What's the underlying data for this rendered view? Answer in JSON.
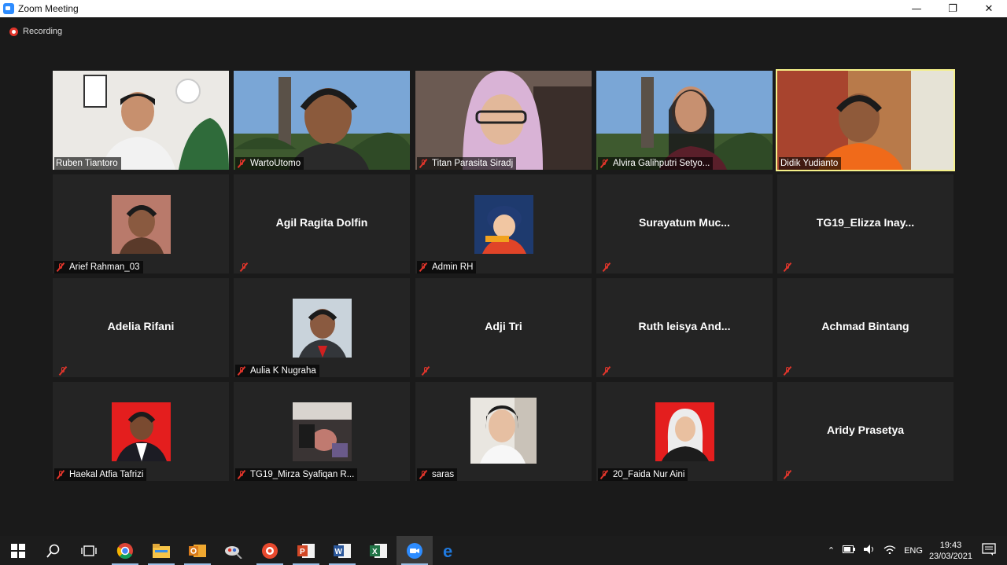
{
  "window": {
    "title": "Zoom Meeting",
    "minimize": "—",
    "maximize": "❐",
    "close": "✕"
  },
  "recording": {
    "label": "Recording"
  },
  "participants": [
    {
      "name": "Ruben Tiantoro",
      "video": true,
      "muted": false
    },
    {
      "name": "WartoUtomo",
      "video": true,
      "muted": true
    },
    {
      "name": "Titan Parasita Siradj",
      "video": true,
      "muted": true
    },
    {
      "name": "Alvira Galihputri Setyo...",
      "video": true,
      "muted": true
    },
    {
      "name": "Didik Yudianto",
      "video": true,
      "muted": false,
      "active_speaker": true
    },
    {
      "name": "Arief Rahman_03",
      "avatar": true,
      "muted": true
    },
    {
      "name": "",
      "display_name": "Agil Ragita Dolfin",
      "muted": true
    },
    {
      "name": "Admin RH",
      "avatar": true,
      "muted": true
    },
    {
      "name": "",
      "display_name": "Surayatum Muc...",
      "muted": true
    },
    {
      "name": "",
      "display_name": "TG19_Elizza Inay...",
      "muted": true
    },
    {
      "name": "",
      "display_name": "Adelia Rifani",
      "muted": true
    },
    {
      "name": "Aulia K Nugraha",
      "avatar": true,
      "muted": true
    },
    {
      "name": "",
      "display_name": "Adji Tri",
      "muted": true
    },
    {
      "name": "",
      "display_name": "Ruth leisya And...",
      "muted": true
    },
    {
      "name": "",
      "display_name": "Achmad Bintang",
      "muted": true
    },
    {
      "name": "Haekal Atfia Tafrizi",
      "avatar": true,
      "muted": true
    },
    {
      "name": "TG19_Mirza Syafiqan R...",
      "avatar": true,
      "muted": true
    },
    {
      "name": "saras",
      "avatar": true,
      "muted": true
    },
    {
      "name": "20_Faida Nur Aini",
      "avatar": true,
      "muted": true
    },
    {
      "name": "",
      "display_name": "Aridy Prasetya",
      "muted": true
    }
  ],
  "taskbar": {
    "apps": [
      "start-icon",
      "search-icon",
      "task-view-icon",
      "chrome-icon",
      "file-explorer-icon",
      "outlook-icon",
      "snipping-icon",
      "screen-recorder-icon",
      "powerpoint-icon",
      "word-icon",
      "excel-icon",
      "zoom-icon",
      "edge-icon"
    ],
    "language": "ENG",
    "time": "19:43",
    "date": "23/03/2021"
  },
  "colors": {
    "active_speaker_border": "#f4f089",
    "mute": "#e0352b",
    "tile_bg": "#242424",
    "stage_bg": "#1a1a1a"
  }
}
